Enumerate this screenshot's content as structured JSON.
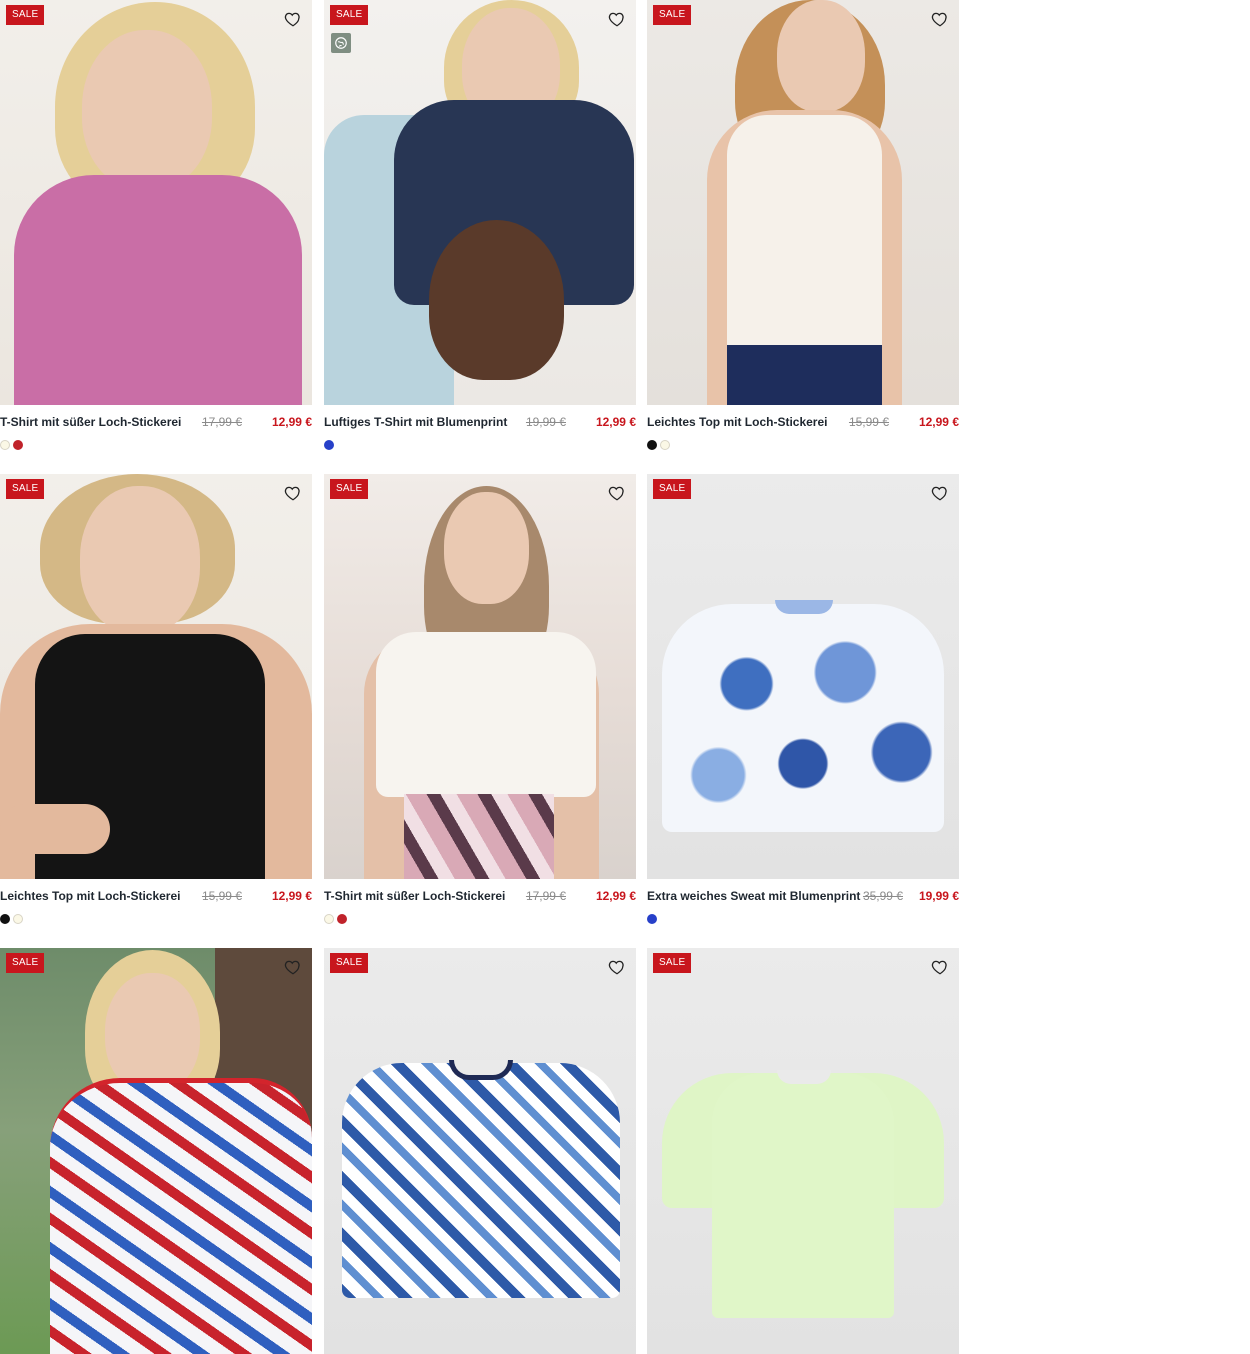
{
  "labels": {
    "sale_badge": "SALE"
  },
  "icons": {
    "wishlist": "heart-outline-icon",
    "sustainability": "globe-leaf-icon"
  },
  "colors": {
    "sale_red": "#c8161d",
    "product_name": "#1f2730",
    "old_price": "#8a8a8a"
  },
  "products": [
    {
      "name": "T-Shirt mit süßer Loch-Stickerei",
      "old_price": "17,99 €",
      "price": "12,99 €",
      "swatches": [
        "#fbf8e6",
        "#c0232b"
      ]
    },
    {
      "name": "Luftiges T-Shirt mit Blumenprint",
      "old_price": "19,99 €",
      "price": "12,99 €",
      "swatches": [
        "#2740c9"
      ],
      "sustainable": true
    },
    {
      "name": "Leichtes Top mit Loch-Stickerei",
      "old_price": "15,99 €",
      "price": "12,99 €",
      "swatches": [
        "#111111",
        "#fbf8e6"
      ]
    },
    {
      "name": "Leichtes Top mit Loch-Stickerei",
      "old_price": "15,99 €",
      "price": "12,99 €",
      "swatches": [
        "#111111",
        "#fbf8e6"
      ]
    },
    {
      "name": "T-Shirt mit süßer Loch-Stickerei",
      "old_price": "17,99 €",
      "price": "12,99 €",
      "swatches": [
        "#fbf8e6",
        "#c0232b"
      ]
    },
    {
      "name": "Extra weiches Sweat mit Blumenprint",
      "old_price": "35,99 €",
      "price": "19,99 €",
      "swatches": [
        "#2740c9"
      ]
    },
    {},
    {},
    {}
  ]
}
